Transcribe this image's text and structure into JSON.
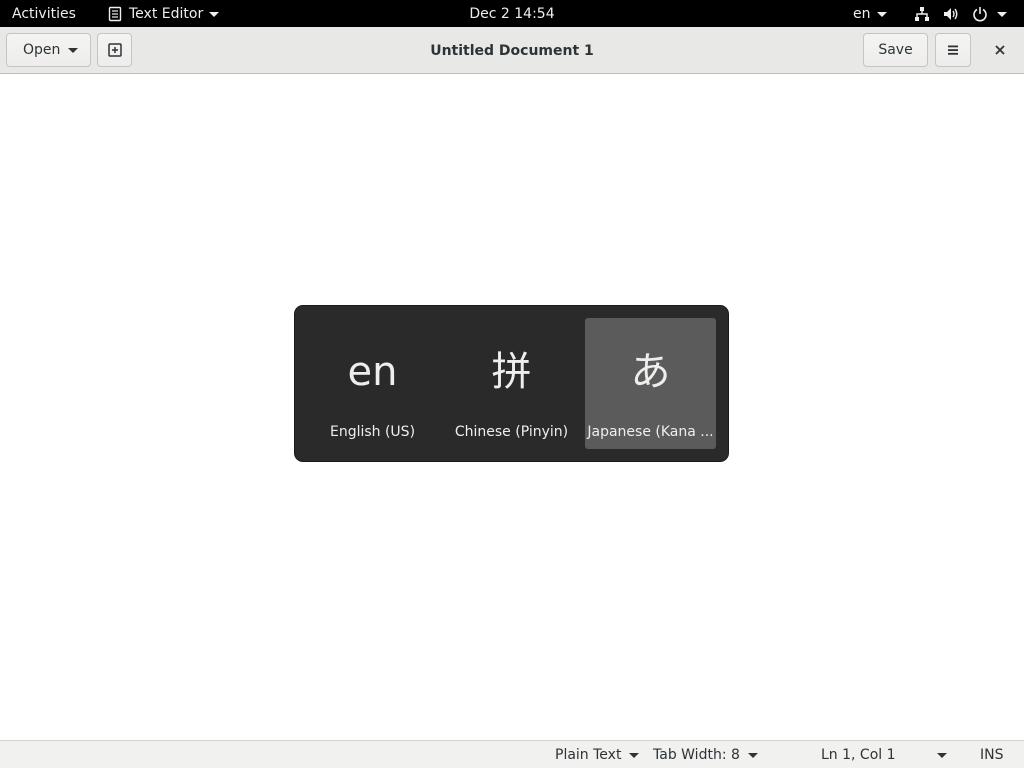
{
  "topbar": {
    "activities": "Activities",
    "app_name": "Text Editor",
    "clock": "Dec 2  14:54",
    "input_source": "en",
    "icons": [
      "document-icon",
      "network-icon",
      "volume-icon",
      "power-icon"
    ]
  },
  "headerbar": {
    "open_label": "Open",
    "title": "Untitled Document 1",
    "save_label": "Save"
  },
  "switcher": {
    "sources": [
      {
        "glyph": "en",
        "label": "English (US)"
      },
      {
        "glyph": "拼",
        "label": "Chinese (Pinyin)"
      },
      {
        "glyph": "あ",
        "label": "Japanese (Kana ..."
      }
    ],
    "selected": "Japanese (Kana ..."
  },
  "statusbar": {
    "language": "Plain Text",
    "tab_width": "Tab Width: 8",
    "position": "Ln 1, Col 1",
    "mode": "INS"
  },
  "colors": {
    "topbar_bg": "#000000",
    "headerbar_bg": "#e8e8e7",
    "switcher_bg": "#2a2a2a",
    "switcher_selected_bg": "#5b5b5b"
  }
}
